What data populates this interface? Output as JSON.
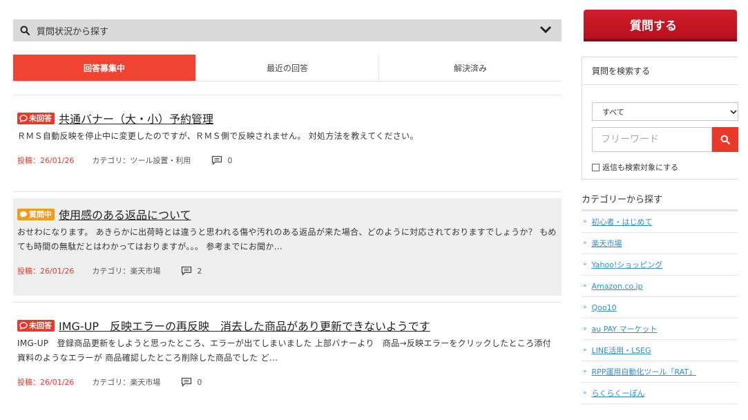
{
  "status_filter": {
    "label": "質問状況から探す",
    "search_icon": "search-icon",
    "toggle_icon": "chevron-down-icon"
  },
  "tabs": [
    {
      "label": "回答募集中",
      "active": true
    },
    {
      "label": "最近の回答",
      "active": false
    },
    {
      "label": "解決済み",
      "active": false
    }
  ],
  "posts": [
    {
      "badge": "未回答",
      "badge_color": "#e8392b",
      "title": "共通バナー（大・小）予約管理",
      "excerpt": "ＲＭＳ自動反映を停止中に変更したのですが、ＲＭＳ側で反映されません。 対処方法を教えてください。",
      "date": "投稿：26/01/26",
      "category": "カテゴリ：ツール設置・利用",
      "comments": "0"
    },
    {
      "badge": "質問中",
      "badge_color": "#f49b1a",
      "title": "使用感のある返品について",
      "excerpt": "おせわになります。 あきらかに出荷時とは違うと思われる傷や汚れのある返品が来た場合、どのように対応されておりますでしょうか？ もめても時間の無駄だとはわかってはおりますが。。。 参考までにお聞か...",
      "date": "投稿：26/01/26",
      "category": "カテゴリ：楽天市場",
      "comments": "2"
    },
    {
      "badge": "未回答",
      "badge_color": "#e8392b",
      "title": "IMG-UP　反映エラーの再反映　消去した商品があり更新できないようです",
      "excerpt": "IMG-UP　登録商品更新をしようと思ったところ、エラーが出てしまいました 上部バナーより　商品→反映エラーをクリックしたところ添付資料のようなエラーが 商品確認したところ削除した商品でした ど...",
      "date": "投稿：26/01/26",
      "category": "カテゴリ：楽天市場",
      "comments": "0"
    }
  ],
  "sidebar": {
    "ask_button": "質問する",
    "search": {
      "heading": "質問を検索する",
      "select_value": "すべて",
      "keyword_placeholder": "フリーワード",
      "include_replies": "返信も検索対象にする"
    },
    "categories_heading": "カテゴリーから探す",
    "categories": [
      "初心者・はじめて",
      "楽天市場",
      "Yahoo!ショッピング",
      "Amazon.co.jp",
      "Qoo10",
      "au PAY マーケット",
      "LINE活用・LSEG",
      "RPP運用自動化ツール「RAT」",
      "らくらくーぽん"
    ]
  },
  "colors": {
    "accent": "#f04433",
    "ask_button": "#c8151f",
    "link": "#2b8fd3",
    "pending_badge": "#f49b1a"
  }
}
